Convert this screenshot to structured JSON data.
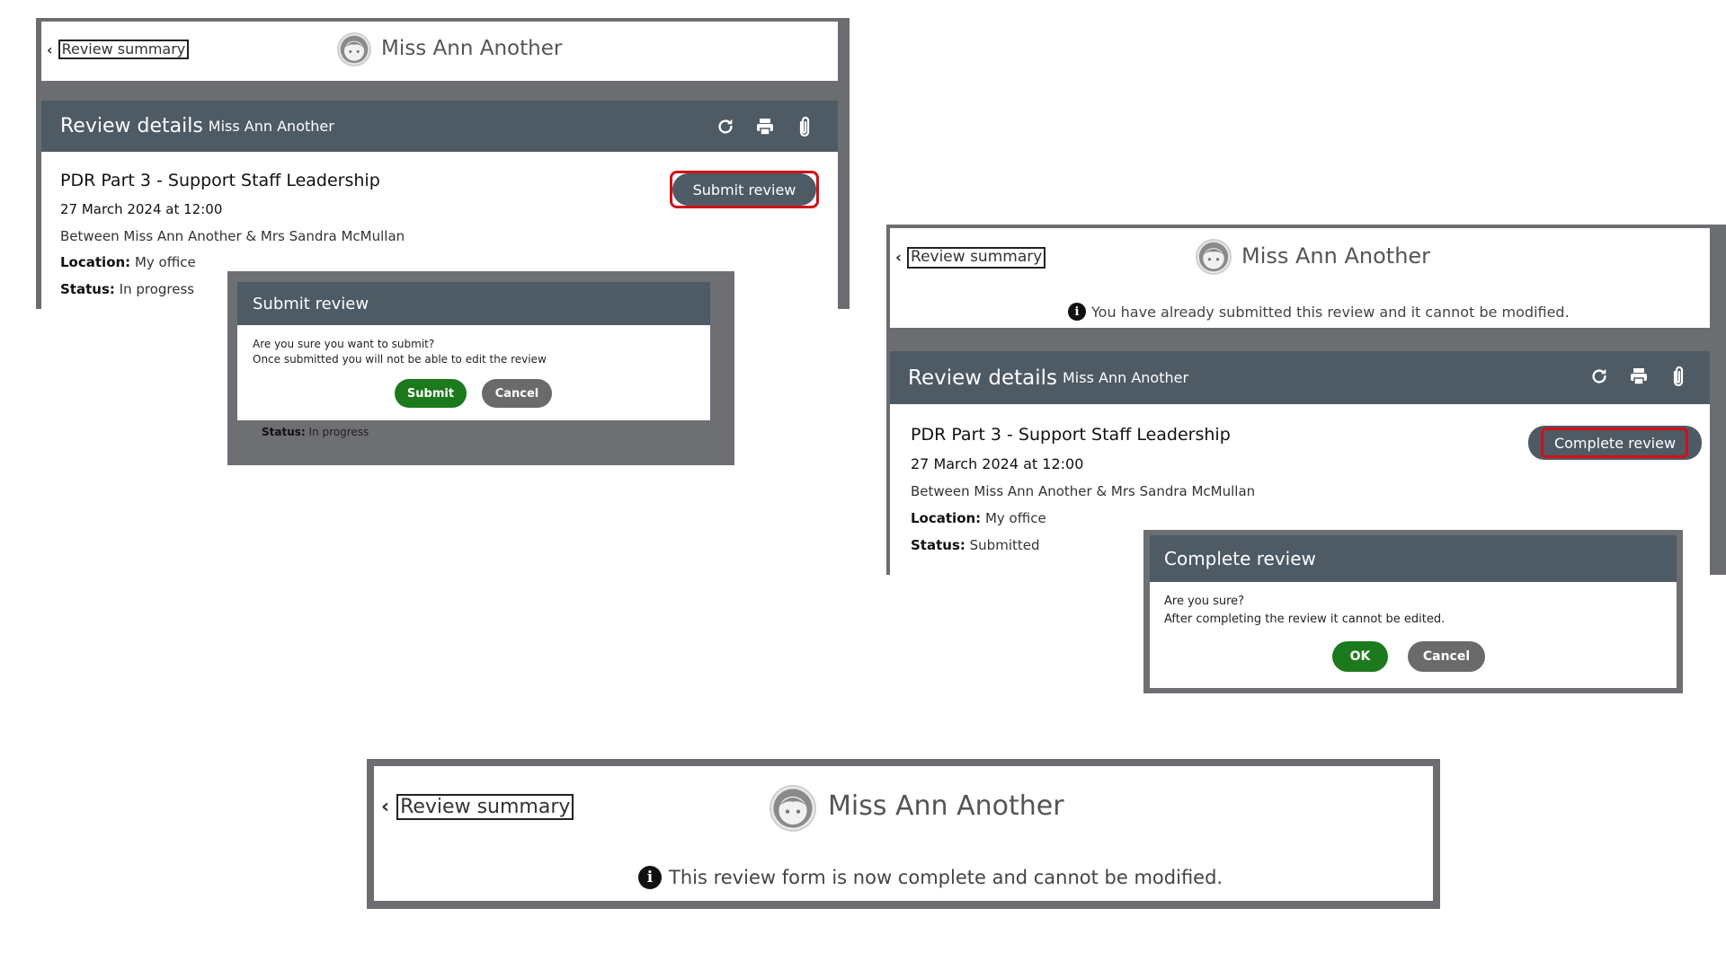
{
  "colors": {
    "bar": "#4e5a64",
    "primary_action": "#1c7a1c",
    "secondary_action": "#6a6a6a",
    "highlight": "#d2101a",
    "overlay": "#6d6f72"
  },
  "panel1": {
    "back_label": "Review summary",
    "user_name": "Miss Ann Another",
    "bar_title": "Review details",
    "bar_subtitle": "Miss Ann Another",
    "icons": [
      "refresh-icon",
      "print-icon",
      "attachment-icon"
    ],
    "review_title": "PDR Part 3 - Support Staff Leadership",
    "date": "27 March 2024 at 12:00",
    "between": "Between Miss Ann Another & Mrs Sandra McMullan",
    "location_label": "Location:",
    "location_value": "My office",
    "status_label": "Status:",
    "status_value": "In progress",
    "action_button": "Submit review",
    "dialog": {
      "title": "Submit review",
      "line1": "Are you sure you want to submit?",
      "line2": "Once submitted you will not be able to edit the review",
      "confirm": "Submit",
      "cancel": "Cancel",
      "bg_status_label": "Status:",
      "bg_status_value": "In progress"
    }
  },
  "panel2": {
    "back_label": "Review summary",
    "user_name": "Miss Ann Another",
    "notice": "You have already submitted this review and it cannot be modified.",
    "bar_title": "Review details",
    "bar_subtitle": "Miss Ann Another",
    "icons": [
      "refresh-icon",
      "print-icon",
      "attachment-icon"
    ],
    "review_title": "PDR Part 3 - Support Staff Leadership",
    "date": "27 March 2024 at 12:00",
    "between": "Between Miss Ann Another & Mrs Sandra McMullan",
    "location_label": "Location:",
    "location_value": "My office",
    "status_label": "Status:",
    "status_value": "Submitted",
    "action_button": "Complete review",
    "dialog": {
      "title": "Complete review",
      "line1": "Are you sure?",
      "line2": "After completing the review it cannot be edited.",
      "confirm": "OK",
      "cancel": "Cancel"
    }
  },
  "panel3": {
    "back_label": "Review summary",
    "user_name": "Miss Ann Another",
    "notice": "This review form is now complete and cannot be modified."
  }
}
